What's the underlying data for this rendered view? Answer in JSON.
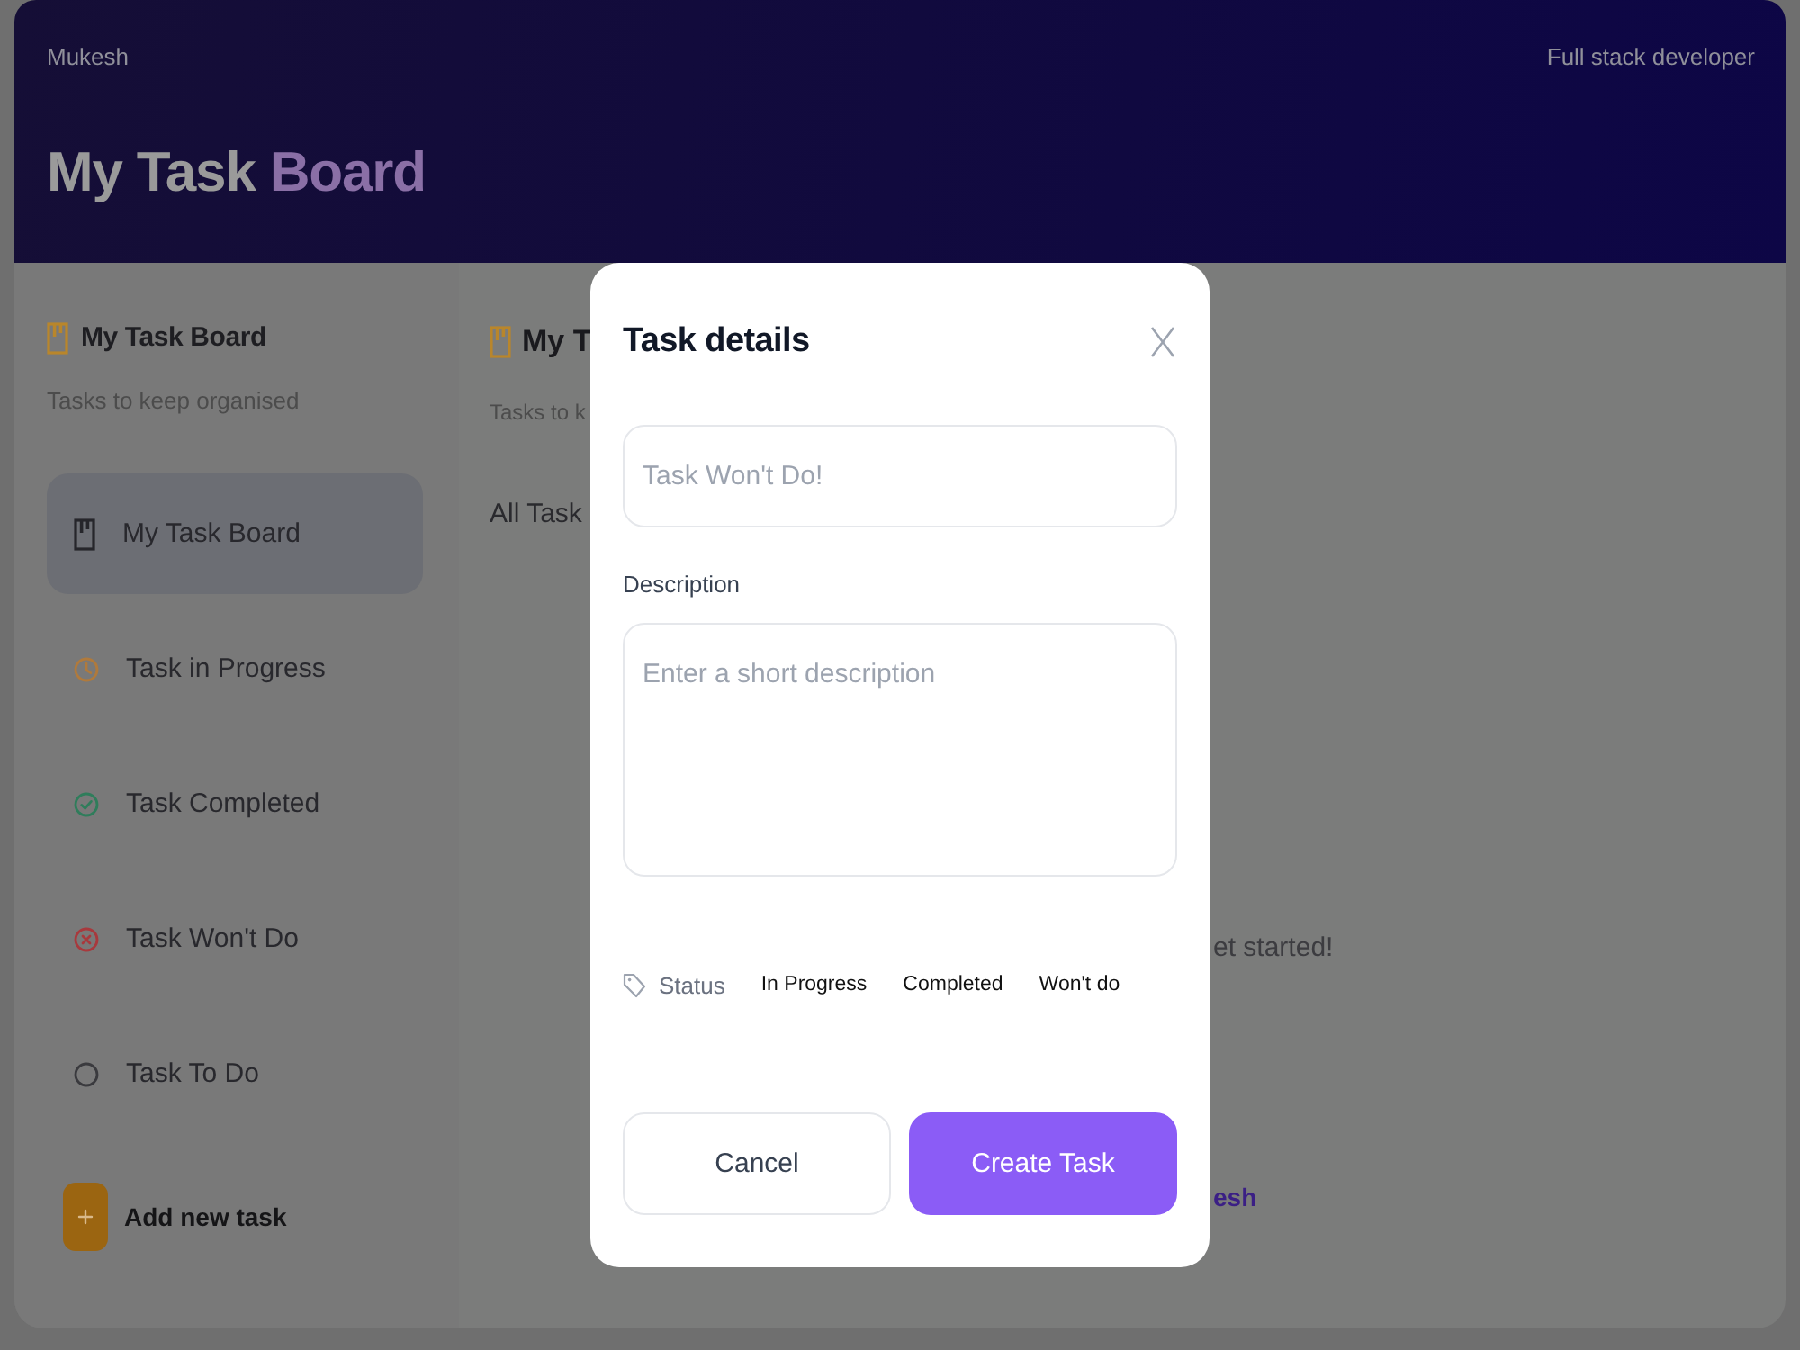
{
  "header": {
    "user": "Mukesh",
    "role": "Full stack developer",
    "title": "My Task",
    "title_accent": "Board"
  },
  "sidebar": {
    "title": "My Task Board",
    "subtitle": "Tasks to keep organised",
    "items": [
      {
        "label": "My Task Board",
        "kind": "board",
        "selected": true
      },
      {
        "label": "Task in Progress",
        "kind": "in_progress",
        "selected": false
      },
      {
        "label": "Task Completed",
        "kind": "completed",
        "selected": false
      },
      {
        "label": "Task Won't Do",
        "kind": "wont_do",
        "selected": false
      },
      {
        "label": "Task To Do",
        "kind": "to_do",
        "selected": false
      }
    ],
    "add_button": "Add new task"
  },
  "main": {
    "title": "My T",
    "subtitle": "Tasks to k",
    "heading": "All Task",
    "empty_message": "et started!",
    "link": "esh"
  },
  "modal": {
    "title": "Task details",
    "name_field": {
      "placeholder": "Task Won't Do!"
    },
    "description_label": "Description",
    "description_field": {
      "placeholder": "Enter a short description"
    },
    "status_label": "Status",
    "status_options": [
      {
        "label": "In Progress",
        "selected": false
      },
      {
        "label": "Completed",
        "selected": false
      },
      {
        "label": "Won't do",
        "selected": false
      }
    ],
    "buttons": [
      {
        "label": "Cancel",
        "kind": "secondary"
      },
      {
        "label": "Create Task",
        "kind": "primary"
      }
    ]
  }
}
